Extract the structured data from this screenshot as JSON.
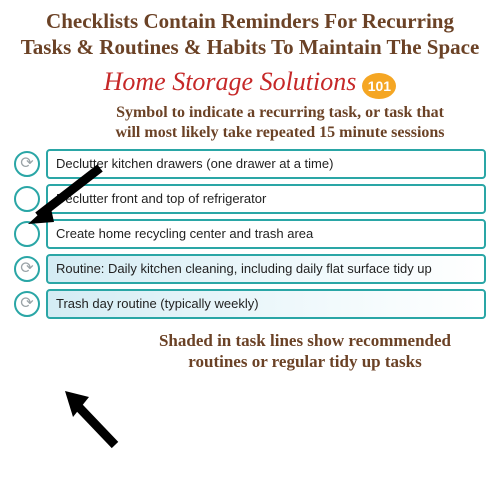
{
  "title": "Checklists Contain Reminders For Recurring Tasks & Routines & Habits To Maintain The Space",
  "brand": {
    "name": "Home Storage Solutions",
    "badge": "101"
  },
  "callout_top": "Symbol to indicate a recurring task, or task that will most likely take repeated 15 minute sessions",
  "callout_bottom": "Shaded in task lines show recommended routines or regular tidy up tasks",
  "recur_glyph": "⟳",
  "rows": [
    {
      "text": "Declutter kitchen drawers (one drawer at a time)",
      "recurring": true,
      "shaded": false
    },
    {
      "text": "Declutter front and top of refrigerator",
      "recurring": false,
      "shaded": false
    },
    {
      "text": "Create home recycling center and trash area",
      "recurring": false,
      "shaded": false
    },
    {
      "text": "Routine: Daily kitchen cleaning, including daily flat surface tidy up",
      "recurring": true,
      "shaded": true
    },
    {
      "text": "Trash day routine (typically weekly)",
      "recurring": true,
      "shaded": true
    }
  ]
}
